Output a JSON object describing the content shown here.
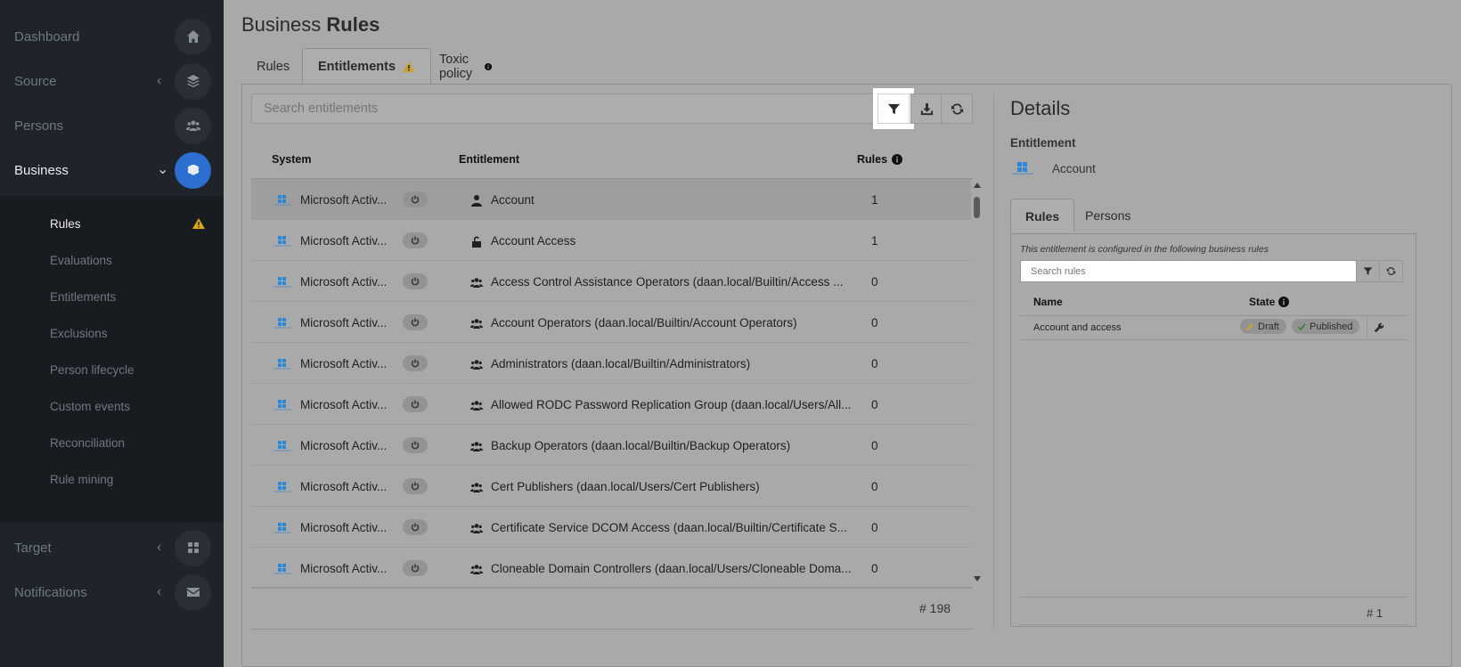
{
  "sidebar": {
    "items": [
      {
        "label": "Dashboard",
        "icon": "home-icon"
      },
      {
        "label": "Source",
        "icon": "layers-icon"
      },
      {
        "label": "Persons",
        "icon": "users-icon"
      },
      {
        "label": "Business",
        "icon": "brain-icon"
      },
      {
        "label": "Target",
        "icon": "grid-icon"
      },
      {
        "label": "Notifications",
        "icon": "envelope-icon"
      }
    ],
    "sub_items": [
      "Rules",
      "Evaluations",
      "Entitlements",
      "Exclusions",
      "Person lifecycle",
      "Custom events",
      "Reconciliation",
      "Rule mining"
    ]
  },
  "page": {
    "title_light": "Business",
    "title_bold": "Rules"
  },
  "tabs": [
    {
      "label": "Rules"
    },
    {
      "label": "Entitlements"
    },
    {
      "label": "Toxic policy"
    }
  ],
  "search": {
    "placeholder": "Search entitlements"
  },
  "table": {
    "headers": {
      "system": "System",
      "entitlement": "Entitlement",
      "rules": "Rules"
    },
    "rows": [
      {
        "system": "Microsoft Activ...",
        "icon": "person-icon",
        "entitlement": "Account",
        "rules": "1"
      },
      {
        "system": "Microsoft Activ...",
        "icon": "unlock-icon",
        "entitlement": "Account Access",
        "rules": "1"
      },
      {
        "system": "Microsoft Activ...",
        "icon": "group-icon",
        "entitlement": "Access Control Assistance Operators (daan.local/Builtin/Access ...",
        "rules": "0"
      },
      {
        "system": "Microsoft Activ...",
        "icon": "group-icon",
        "entitlement": "Account Operators (daan.local/Builtin/Account Operators)",
        "rules": "0"
      },
      {
        "system": "Microsoft Activ...",
        "icon": "group-icon",
        "entitlement": "Administrators (daan.local/Builtin/Administrators)",
        "rules": "0"
      },
      {
        "system": "Microsoft Activ...",
        "icon": "group-icon",
        "entitlement": "Allowed RODC Password Replication Group (daan.local/Users/All...",
        "rules": "0"
      },
      {
        "system": "Microsoft Activ...",
        "icon": "group-icon",
        "entitlement": "Backup Operators (daan.local/Builtin/Backup Operators)",
        "rules": "0"
      },
      {
        "system": "Microsoft Activ...",
        "icon": "group-icon",
        "entitlement": "Cert Publishers (daan.local/Users/Cert Publishers)",
        "rules": "0"
      },
      {
        "system": "Microsoft Activ...",
        "icon": "group-icon",
        "entitlement": "Certificate Service DCOM Access (daan.local/Builtin/Certificate S...",
        "rules": "0"
      },
      {
        "system": "Microsoft Activ...",
        "icon": "group-icon",
        "entitlement": "Cloneable Domain Controllers (daan.local/Users/Cloneable Doma...",
        "rules": "0"
      }
    ],
    "count": "# 198"
  },
  "details": {
    "title": "Details",
    "entitlement_label": "Entitlement",
    "entitlement_name": "Account",
    "tabs": [
      "Rules",
      "Persons"
    ],
    "note": "This entitlement is configured in the following business rules",
    "search_placeholder": "Search rules",
    "headers": {
      "name": "Name",
      "state": "State"
    },
    "rows": [
      {
        "name": "Account and access",
        "draft": "Draft",
        "published": "Published"
      }
    ],
    "count": "# 1"
  },
  "colors": {
    "accent": "#2c6fd0",
    "warning": "#d9a81e",
    "sidebar": "#1f242b"
  }
}
